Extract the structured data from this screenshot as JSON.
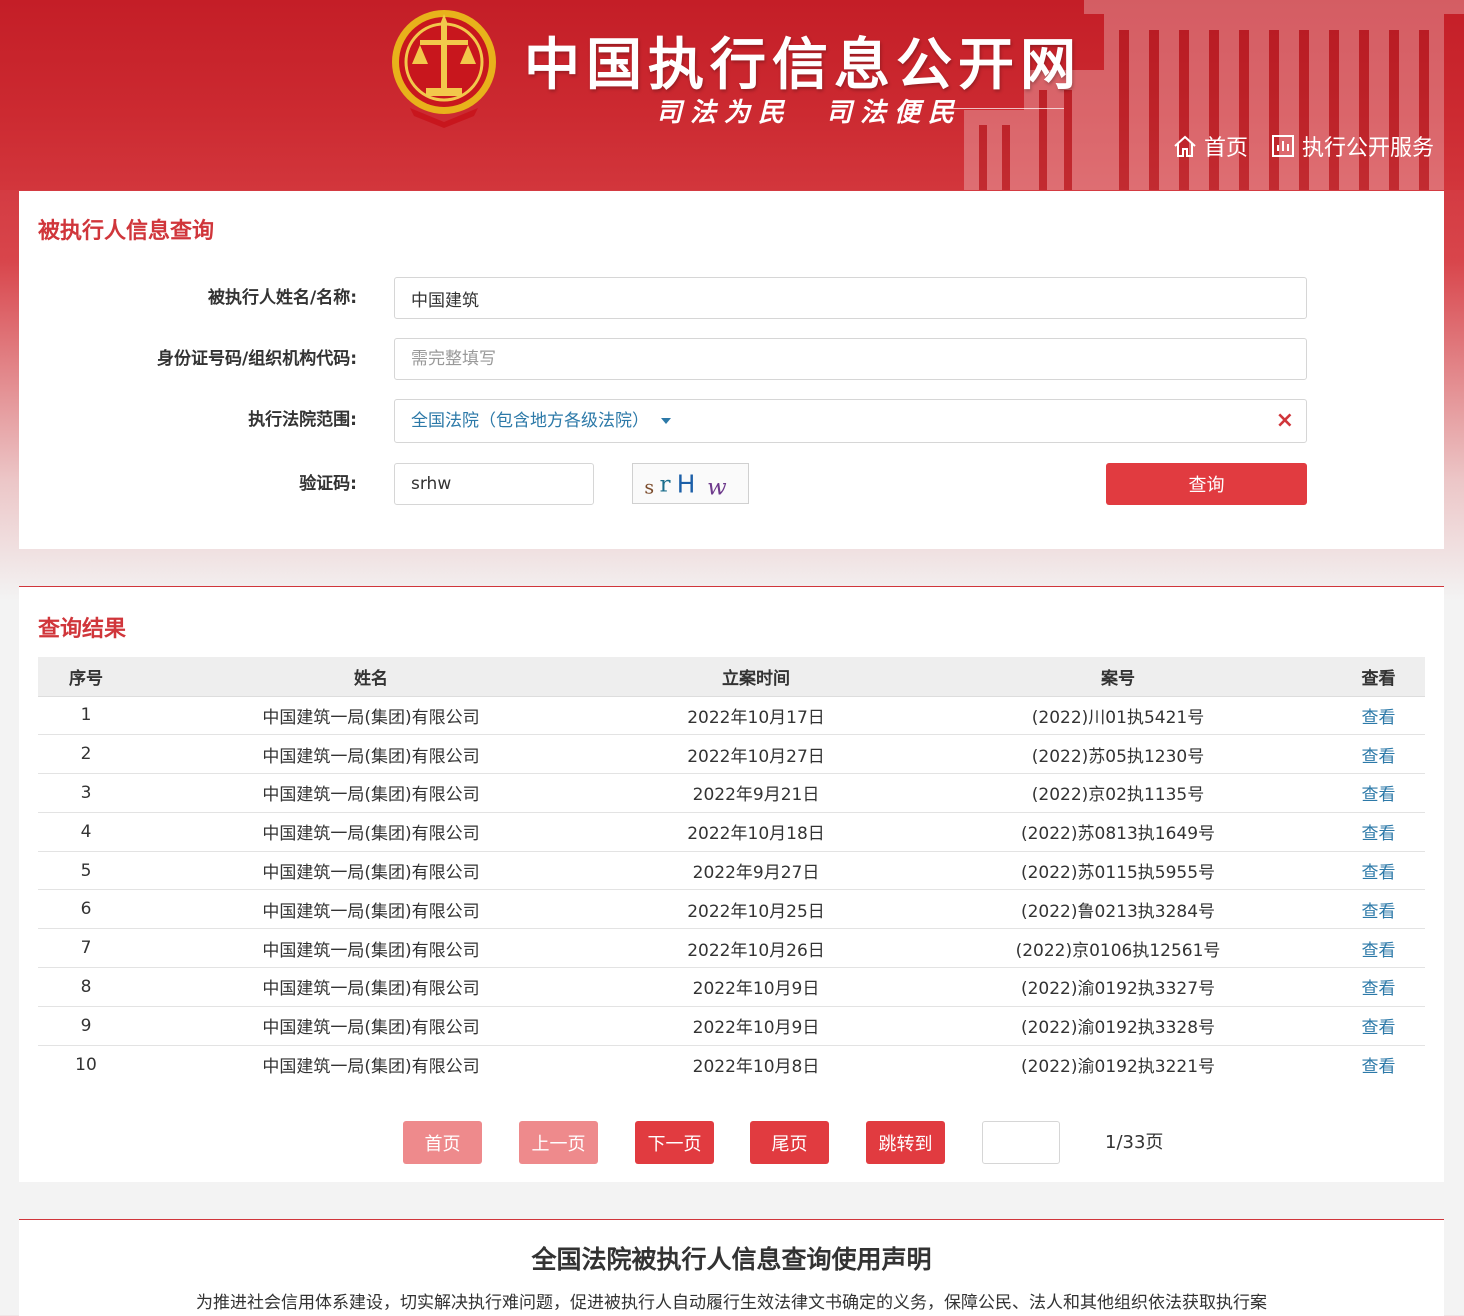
{
  "header": {
    "site_title": "中国执行信息公开网",
    "slogan": "司法为民　司法便民",
    "nav": [
      {
        "label": "首页",
        "icon": "home-icon"
      },
      {
        "label": "执行公开服务",
        "icon": "chart-icon"
      }
    ]
  },
  "query": {
    "title": "被执行人信息查询",
    "name_label": "被执行人姓名/名称:",
    "name_value": "中国建筑",
    "id_label": "身份证号码/组织机构代码:",
    "id_placeholder": "需完整填写",
    "court_label": "执行法院范围:",
    "court_value": "全国法院（包含地方各级法院）",
    "captcha_label": "验证码:",
    "captcha_value": "srhw",
    "captcha_image_text": "srHw",
    "submit_label": "查询",
    "clear_symbol": "×"
  },
  "results": {
    "title": "查询结果",
    "columns": [
      "序号",
      "姓名",
      "立案时间",
      "案号",
      "查看"
    ],
    "rows": [
      {
        "no": "1",
        "name": "中国建筑一局(集团)有限公司",
        "date": "2022年10月17日",
        "case": "(2022)川01执5421号",
        "view": "查看"
      },
      {
        "no": "2",
        "name": "中国建筑一局(集团)有限公司",
        "date": "2022年10月27日",
        "case": "(2022)苏05执1230号",
        "view": "查看"
      },
      {
        "no": "3",
        "name": "中国建筑一局(集团)有限公司",
        "date": "2022年9月21日",
        "case": "(2022)京02执1135号",
        "view": "查看"
      },
      {
        "no": "4",
        "name": "中国建筑一局(集团)有限公司",
        "date": "2022年10月18日",
        "case": "(2022)苏0813执1649号",
        "view": "查看"
      },
      {
        "no": "5",
        "name": "中国建筑一局(集团)有限公司",
        "date": "2022年9月27日",
        "case": "(2022)苏0115执5955号",
        "view": "查看"
      },
      {
        "no": "6",
        "name": "中国建筑一局(集团)有限公司",
        "date": "2022年10月25日",
        "case": "(2022)鲁0213执3284号",
        "view": "查看"
      },
      {
        "no": "7",
        "name": "中国建筑一局(集团)有限公司",
        "date": "2022年10月26日",
        "case": "(2022)京0106执12561号",
        "view": "查看"
      },
      {
        "no": "8",
        "name": "中国建筑一局(集团)有限公司",
        "date": "2022年10月9日",
        "case": "(2022)渝0192执3327号",
        "view": "查看"
      },
      {
        "no": "9",
        "name": "中国建筑一局(集团)有限公司",
        "date": "2022年10月9日",
        "case": "(2022)渝0192执3328号",
        "view": "查看"
      },
      {
        "no": "10",
        "name": "中国建筑一局(集团)有限公司",
        "date": "2022年10月8日",
        "case": "(2022)渝0192执3221号",
        "view": "查看"
      }
    ],
    "pager": {
      "first": "首页",
      "prev": "上一页",
      "next": "下一页",
      "last": "尾页",
      "jump": "跳转到",
      "info": "1/33页"
    }
  },
  "notice": {
    "title": "全国法院被执行人信息查询使用声明",
    "text": "为推进社会信用体系建设，切实解决执行难问题，促进被执行人自动履行生效法律文书确定的义务，保障公民、法人和其他组织依法获取执行案"
  },
  "colors": {
    "brand_red": "#d0363b",
    "button_red": "#e13b40",
    "disabled_red": "#ee8a8c",
    "link_blue": "#2c79a8"
  }
}
